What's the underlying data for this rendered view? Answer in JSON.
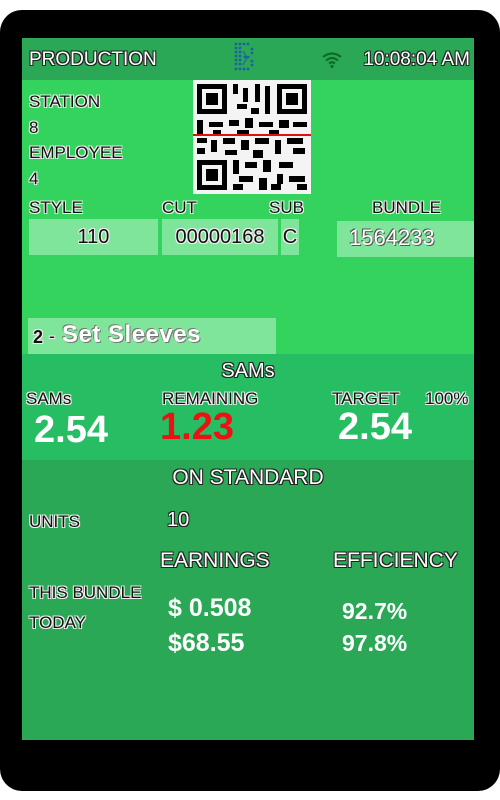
{
  "header": {
    "title": "PRODUCTION",
    "time": "10:08:04 AM",
    "logo_icon": "brand-logo-icon",
    "wifi_icon": "wifi-icon"
  },
  "station": {
    "label": "STATION",
    "value": "8"
  },
  "employee": {
    "label": "EMPLOYEE",
    "value": "4"
  },
  "qr_code": {
    "icon": "qr-code-icon",
    "scan_line_color": "#e01010"
  },
  "fields": {
    "style": {
      "label": "STYLE",
      "value": "110"
    },
    "cut": {
      "label": "CUT",
      "value": "00000168"
    },
    "sub": {
      "label": "SUB",
      "value": "C"
    },
    "bundle": {
      "label": "BUNDLE",
      "value": "1564233"
    }
  },
  "operation": {
    "number": "2",
    "separator": "-",
    "name": "Set Sleeves"
  },
  "sams": {
    "section_title": "SAMs",
    "sams_label": "SAMs",
    "sams_value": "2.54",
    "remaining_label": "REMAINING",
    "remaining_value": "1.23",
    "target_label": "TARGET",
    "target_percent": "100%",
    "target_value": "2.54",
    "remaining_color": "#ee1111"
  },
  "standard": {
    "status": "ON STANDARD",
    "units_label": "UNITS",
    "units_value": "10",
    "earnings_header": "EARNINGS",
    "efficiency_header": "EFFICIENCY",
    "rows": [
      {
        "label": "THIS BUNDLE",
        "earnings": "$ 0.508",
        "efficiency": "92.7%"
      },
      {
        "label": "TODAY",
        "earnings": "$68.55",
        "efficiency": "97.8%"
      }
    ]
  }
}
